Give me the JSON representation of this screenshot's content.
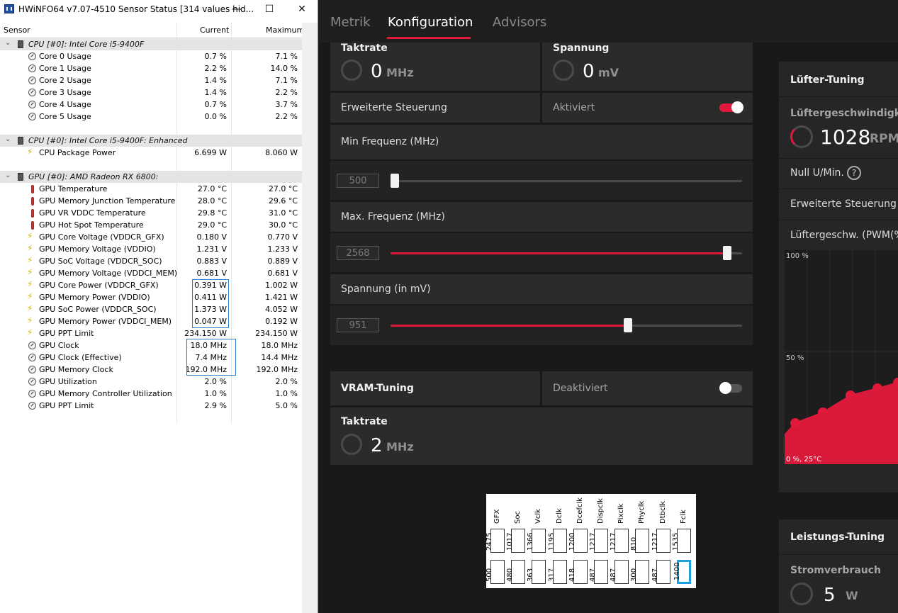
{
  "hwinfo": {
    "title": "HWiNFO64 v7.07-4510 Sensor Status [314 values hid...",
    "columns": {
      "sensor": "Sensor",
      "current": "Current",
      "maximum": "Maximum"
    },
    "groups": [
      {
        "label": "CPU [#0]: Intel Core i5-9400F",
        "rows": [
          {
            "icon": "gauge",
            "label": "Core 0 Usage",
            "current": "0.7 %",
            "maximum": "7.1 %"
          },
          {
            "icon": "gauge",
            "label": "Core 1 Usage",
            "current": "2.2 %",
            "maximum": "14.0 %"
          },
          {
            "icon": "gauge",
            "label": "Core 2 Usage",
            "current": "1.4 %",
            "maximum": "7.1 %"
          },
          {
            "icon": "gauge",
            "label": "Core 3 Usage",
            "current": "1.4 %",
            "maximum": "2.2 %"
          },
          {
            "icon": "gauge",
            "label": "Core 4 Usage",
            "current": "0.7 %",
            "maximum": "3.7 %"
          },
          {
            "icon": "gauge",
            "label": "Core 5 Usage",
            "current": "0.0 %",
            "maximum": "2.2 %"
          }
        ]
      },
      {
        "label": "CPU [#0]: Intel Core i5-9400F: Enhanced",
        "rows": [
          {
            "icon": "bolt",
            "label": "CPU Package Power",
            "current": "6.699 W",
            "maximum": "8.060 W"
          }
        ]
      },
      {
        "label": "GPU [#0]: AMD Radeon RX 6800:",
        "rows": [
          {
            "icon": "therm",
            "label": "GPU Temperature",
            "current": "27.0 °C",
            "maximum": "27.0 °C"
          },
          {
            "icon": "therm",
            "label": "GPU Memory Junction Temperature",
            "current": "28.0 °C",
            "maximum": "29.6 °C"
          },
          {
            "icon": "therm",
            "label": "GPU VR VDDC Temperature",
            "current": "29.8 °C",
            "maximum": "31.0 °C"
          },
          {
            "icon": "therm",
            "label": "GPU Hot Spot Temperature",
            "current": "29.0 °C",
            "maximum": "30.0 °C"
          },
          {
            "icon": "bolt",
            "label": "GPU Core Voltage (VDDCR_GFX)",
            "current": "0.180 V",
            "maximum": "0.770 V"
          },
          {
            "icon": "bolt",
            "label": "GPU Memory Voltage (VDDIO)",
            "current": "1.231 V",
            "maximum": "1.233 V"
          },
          {
            "icon": "bolt",
            "label": "GPU SoC Voltage (VDDCR_SOC)",
            "current": "0.883 V",
            "maximum": "0.889 V"
          },
          {
            "icon": "bolt",
            "label": "GPU Memory Voltage (VDDCI_MEM)",
            "current": "0.681 V",
            "maximum": "0.681 V"
          },
          {
            "icon": "bolt",
            "label": "GPU Core Power (VDDCR_GFX)",
            "current": "0.391 W",
            "maximum": "1.002 W"
          },
          {
            "icon": "bolt",
            "label": "GPU Memory Power (VDDIO)",
            "current": "0.411 W",
            "maximum": "1.421 W"
          },
          {
            "icon": "bolt",
            "label": "GPU SoC Power (VDDCR_SOC)",
            "current": "1.373 W",
            "maximum": "4.052 W"
          },
          {
            "icon": "bolt",
            "label": "GPU Memory Power (VDDCI_MEM)",
            "current": "0.047 W",
            "maximum": "0.192 W"
          },
          {
            "icon": "bolt",
            "label": "GPU PPT Limit",
            "current": "234.150 W",
            "maximum": "234.150 W"
          },
          {
            "icon": "gauge",
            "label": "GPU Clock",
            "current": "18.0 MHz",
            "maximum": "18.0 MHz"
          },
          {
            "icon": "gauge",
            "label": "GPU Clock (Effective)",
            "current": "7.4 MHz",
            "maximum": "14.4 MHz"
          },
          {
            "icon": "gauge",
            "label": "GPU Memory Clock",
            "current": "192.0 MHz",
            "maximum": "192.0 MHz"
          },
          {
            "icon": "gauge",
            "label": "GPU Utilization",
            "current": "2.0 %",
            "maximum": "2.0 %"
          },
          {
            "icon": "gauge",
            "label": "GPU Memory Controller Utilization",
            "current": "1.0 %",
            "maximum": "1.0 %"
          },
          {
            "icon": "gauge",
            "label": "GPU PPT Limit",
            "current": "2.9 %",
            "maximum": "5.0 %"
          }
        ]
      }
    ]
  },
  "amd": {
    "tabs": [
      "Metrik",
      "Konfiguration",
      "Advisors"
    ],
    "active_tab": 1,
    "gpu": {
      "taktrate_label": "Taktrate",
      "taktrate_value": "0",
      "taktrate_unit": "MHz",
      "spannung_label": "Spannung",
      "spannung_value": "0",
      "spannung_unit": "mV",
      "erweitert_label": "Erweiterte Steuerung",
      "erweitert_state": "Aktiviert",
      "min_label": "Min Frequenz (MHz)",
      "min_value": "500",
      "max_label": "Max. Frequenz (MHz)",
      "max_value": "2568",
      "volt_label": "Spannung (in mV)",
      "volt_value": "951",
      "sliders": {
        "min": 0.0,
        "max": 0.97,
        "volt": 0.68
      }
    },
    "vram": {
      "title": "VRAM-Tuning",
      "state": "Deaktiviert",
      "taktrate_label": "Taktrate",
      "taktrate_value": "2",
      "taktrate_unit": "MHz"
    },
    "fan": {
      "title": "Lüfter-Tuning",
      "speed_label": "Lüftergeschwindigkeit",
      "speed_value": "1028",
      "speed_unit": "RPM",
      "zero_rpm_label": "Null U/Min.",
      "erweitert_label": "Erweiterte Steuerung",
      "pwm_label": "Lüftergeschw. (PWM(%))/",
      "curve": {
        "y_top": "100 %",
        "y_mid": "50 %",
        "origin": "0 %, 25°C"
      }
    },
    "power": {
      "title": "Leistungs-Tuning",
      "stromverbrauch_label": "Stromverbrauch",
      "value": "5",
      "unit": "W"
    },
    "colors": {
      "accent": "#e0193a",
      "panel": "#2b2b2b",
      "bg": "#191919"
    }
  },
  "clocks": {
    "columns": [
      {
        "name": "GFX",
        "top": "2475",
        "bottom": "500"
      },
      {
        "name": "Soc",
        "top": "1017",
        "bottom": "480"
      },
      {
        "name": "Vclk",
        "top": "1366",
        "bottom": "363"
      },
      {
        "name": "Dclk",
        "top": "1195",
        "bottom": "317"
      },
      {
        "name": "Dcefclk",
        "top": "1200",
        "bottom": "418"
      },
      {
        "name": "Dispclk",
        "top": "1217",
        "bottom": "487"
      },
      {
        "name": "Pixclk",
        "top": "1217",
        "bottom": "487"
      },
      {
        "name": "Phyclk",
        "top": "810",
        "bottom": "300"
      },
      {
        "name": "Dtbclk",
        "top": "1217",
        "bottom": "487"
      },
      {
        "name": "Fclk",
        "top": "1535",
        "bottom": "1400"
      }
    ],
    "selected": 9
  }
}
